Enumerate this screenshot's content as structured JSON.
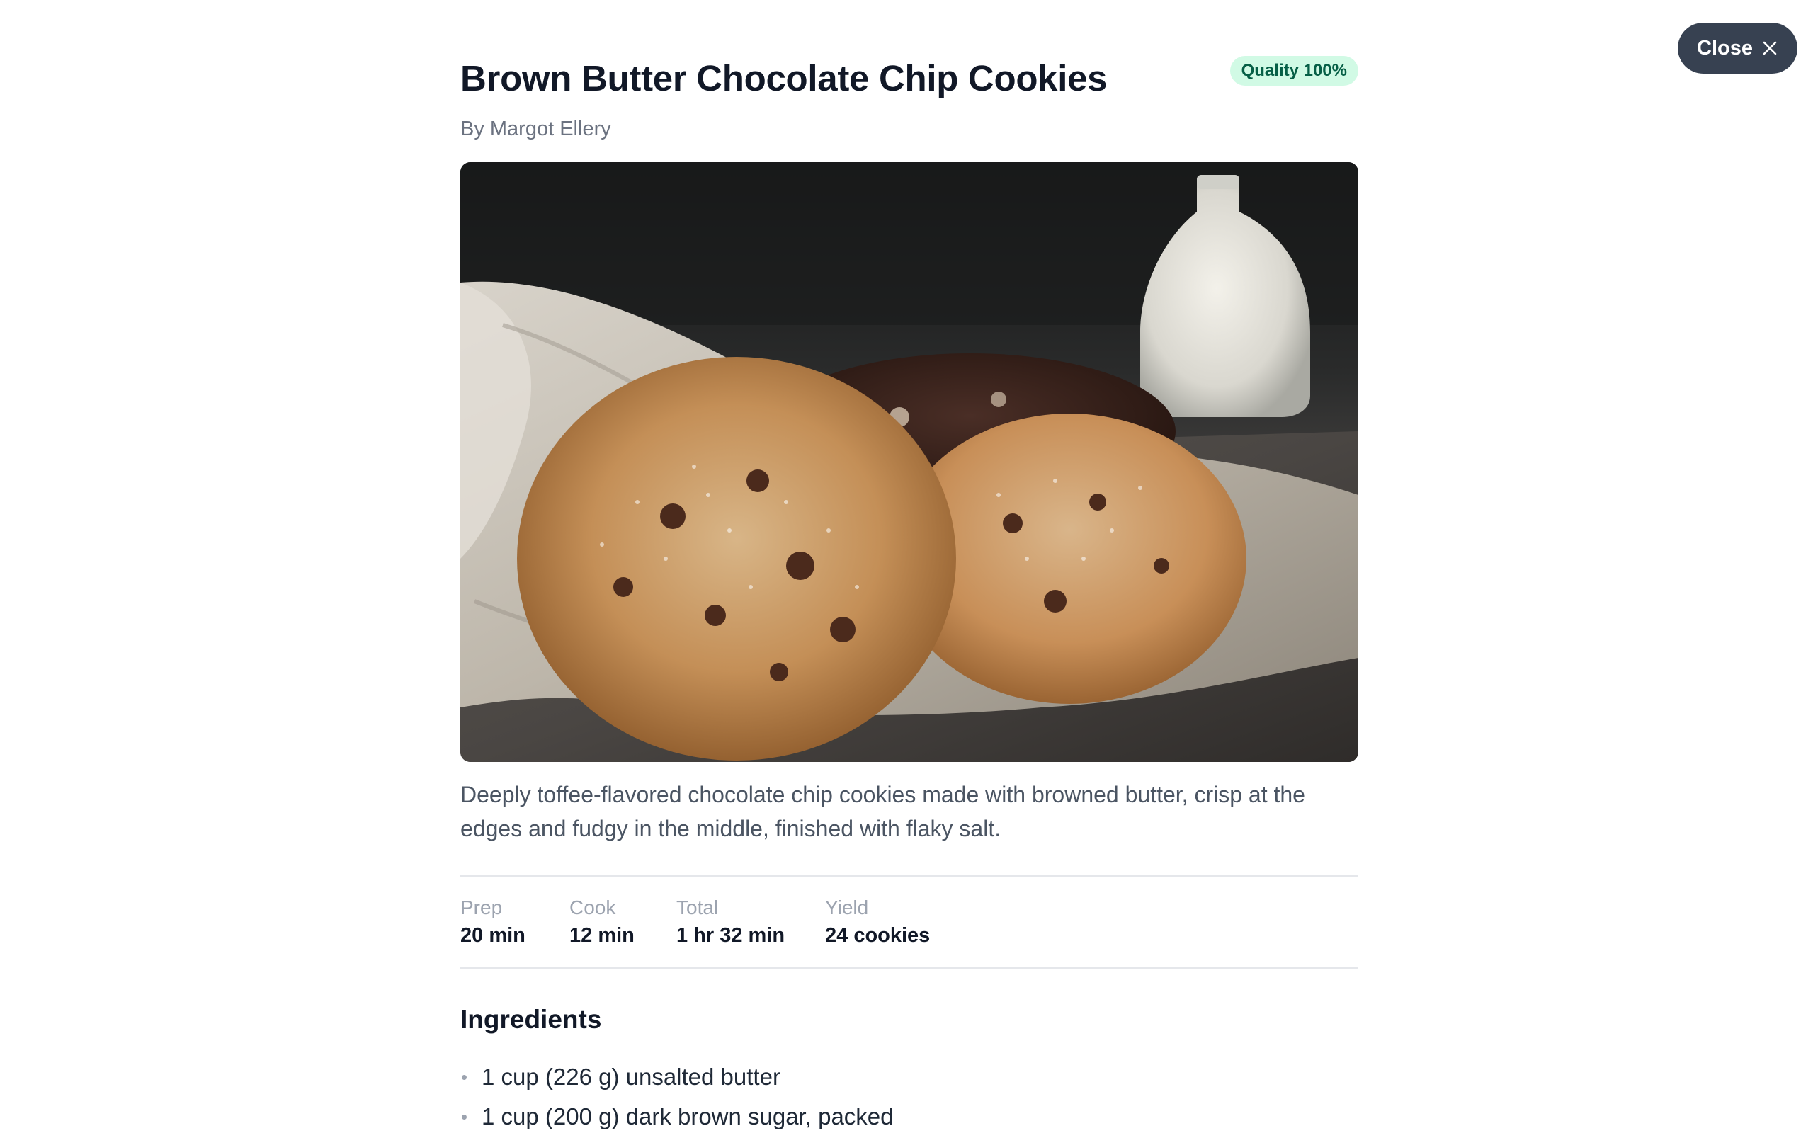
{
  "close_button": {
    "label": "Close",
    "icon": "close-icon"
  },
  "recipe": {
    "title": "Brown Butter Chocolate Chip Cookies",
    "quality_badge": "Quality 100%",
    "author": "By Margot Ellery",
    "image_icon": "cookies-photo",
    "description": "Deeply toffee-flavored chocolate chip cookies made with browned butter, crisp at the edges and fudgy in the middle, finished with flaky salt.",
    "times": [
      {
        "label": "Prep",
        "value": "20 min"
      },
      {
        "label": "Cook",
        "value": "12 min"
      },
      {
        "label": "Total",
        "value": "1 hr 32 min"
      },
      {
        "label": "Yield",
        "value": "24 cookies"
      }
    ],
    "ingredients_heading": "Ingredients",
    "ingredients": [
      "1 cup (226 g) unsalted butter",
      "1 cup (200 g) dark brown sugar, packed"
    ]
  },
  "colors": {
    "close_button_bg": "#374151",
    "badge_bg": "#d1fae5",
    "badge_text": "#065f46",
    "title": "#111827",
    "muted": "#6b7280"
  }
}
